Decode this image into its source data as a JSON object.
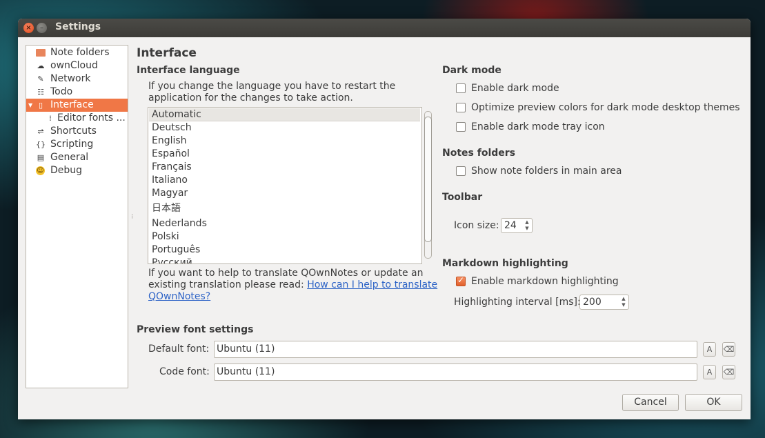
{
  "window": {
    "title": "Settings"
  },
  "titlebar": {
    "close_glyph": "×",
    "min_glyph": "–"
  },
  "sidebar": {
    "items": [
      {
        "label": "Note folders",
        "icon": "folder-icon"
      },
      {
        "label": "ownCloud",
        "icon": "cloud-icon"
      },
      {
        "label": "Network",
        "icon": "network-icon"
      },
      {
        "label": "Todo",
        "icon": "todo-icon"
      },
      {
        "label": "Interface",
        "icon": "interface-icon",
        "selected": true
      },
      {
        "label": "Editor fonts ...",
        "icon": "editor-fonts-icon",
        "child": true
      },
      {
        "label": "Shortcuts",
        "icon": "shortcuts-icon"
      },
      {
        "label": "Scripting",
        "icon": "scripting-icon"
      },
      {
        "label": "General",
        "icon": "general-icon"
      },
      {
        "label": "Debug",
        "icon": "debug-icon"
      }
    ]
  },
  "page": {
    "title": "Interface"
  },
  "language": {
    "heading": "Interface language",
    "note_line1": "If you change the language you have to restart the",
    "note_line2": "application for the changes to take action.",
    "options": [
      "Automatic",
      "Deutsch",
      "English",
      "Español",
      "Français",
      "Italiano",
      "Magyar",
      "日本語",
      "Nederlands",
      "Polski",
      "Português",
      "Русский"
    ],
    "selected": "Automatic",
    "help_line1": "If you want to help to translate QOwnNotes or update an",
    "help_line2_prefix": "existing translation please read: ",
    "help_link_part1": "How can I help to translate",
    "help_link_part2": "QOwnNotes?"
  },
  "dark_mode": {
    "heading": "Dark mode",
    "enable": {
      "label": "Enable dark mode",
      "checked": false
    },
    "optimize": {
      "label": "Optimize preview colors for dark mode desktop themes",
      "checked": false
    },
    "tray": {
      "label": "Enable dark mode tray icon",
      "checked": false
    }
  },
  "notes_folders": {
    "heading": "Notes folders",
    "show": {
      "label": "Show note folders in main area",
      "checked": false
    }
  },
  "toolbar": {
    "heading": "Toolbar",
    "icon_size_label": "Icon size:",
    "icon_size": "24"
  },
  "markdown": {
    "heading": "Markdown highlighting",
    "enable": {
      "label": "Enable markdown highlighting",
      "checked": true
    },
    "interval_label": "Highlighting interval [ms]:",
    "interval": "200"
  },
  "preview_font": {
    "heading": "Preview font settings",
    "default_label": "Default font:",
    "default_value": "Ubuntu (11)",
    "code_label": "Code font:",
    "code_value": "Ubuntu (11)",
    "choose_glyph": "A",
    "reset_glyph": "⌫"
  },
  "buttons": {
    "cancel": "Cancel",
    "ok": "OK"
  },
  "colors": {
    "accent": "#f07746",
    "titlebar": "#3d3c38",
    "window_bg": "#f2f1f0",
    "link": "#2d63c6"
  }
}
